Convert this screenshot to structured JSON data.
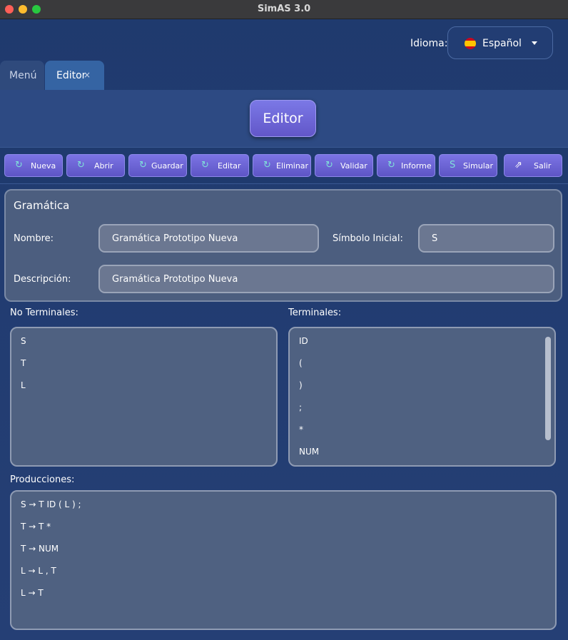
{
  "window": {
    "title": "SimAS 3.0"
  },
  "language": {
    "label": "Idioma:",
    "value": "Español",
    "flag": "spain-flag"
  },
  "tabs": [
    {
      "label": "Menú"
    },
    {
      "label": "Editor",
      "close": "×"
    }
  ],
  "header": {
    "editor_button": "Editor"
  },
  "toolbar": [
    {
      "label": "Nueva",
      "icon": "new-icon"
    },
    {
      "label": "Abrir",
      "icon": "open-icon"
    },
    {
      "label": "Guardar",
      "icon": "save-icon"
    },
    {
      "label": "Editar",
      "icon": "edit-icon"
    },
    {
      "label": "Eliminar",
      "icon": "delete-icon"
    },
    {
      "label": "Validar",
      "icon": "validate-icon"
    },
    {
      "label": "Informe",
      "icon": "report-icon"
    },
    {
      "label": "Simular",
      "icon": "simulate-icon"
    },
    {
      "label": "Salir",
      "icon": "exit-icon"
    }
  ],
  "grammar": {
    "title": "Gramática",
    "name_label": "Nombre:",
    "name_value": "Gramática Prototipo Nueva",
    "initial_label": "Símbolo Inicial:",
    "initial_value": "S",
    "description_label": "Descripción:",
    "description_value": "Gramática Prototipo Nueva"
  },
  "non_terminals": {
    "label": "No Terminales:",
    "items": [
      "S",
      "T",
      "L"
    ]
  },
  "terminals": {
    "label": "Terminales:",
    "items": [
      "ID",
      "(",
      ")",
      ";",
      "*",
      "NUM"
    ]
  },
  "productions": {
    "label": "Producciones:",
    "items": [
      "S → T ID ( L ) ;",
      "T → T *",
      "T → NUM",
      "L → L , T",
      "L → T"
    ]
  }
}
